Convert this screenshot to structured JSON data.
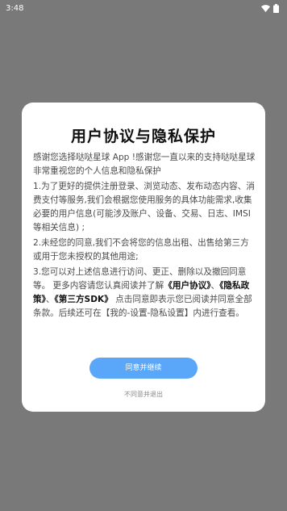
{
  "status_bar": {
    "time": "3:48",
    "icons": [
      "wifi-icon",
      "battery-icon"
    ]
  },
  "dialog": {
    "title": "用户协议与隐私保护",
    "intro": "感谢您选择哒哒星球 App !感谢您一直以来的支持哒哒星球非常重视您的个人信息和隐私保护",
    "item1": "1.为了更好的提供注册登录、浏览动态、发布动态内容、消费支付等服务,我们会根据您使用服务的具体功能需求,收集必要的用户信息(可能涉及账户、设备、交易、日志、IMSI等相关信息) ;",
    "item2": "2.未经您的同意,我们不会将您的信息出租、出售给第三方或用于您未授权的其他用途;",
    "item3_text": "3.您可以对上述信息进行访问、更正、删除以及撤回同意等。 更多内容请您认真阅读并了解",
    "link_user_agreement": "《用户协议》",
    "sep1": "、",
    "link_privacy_policy": "《隐私政策》",
    "sep2": "、",
    "link_third_party_sdk": "《第三方SDK》",
    "item3_tail": " 点击同意即表示您已阅读并同意全部条款。后续还可在【我的-设置-隐私设置】内进行查看。",
    "agree_label": "同意并继续",
    "decline_label": "不同意并退出"
  },
  "colors": {
    "overlay": "#797979",
    "dialog_bg": "#ffffff",
    "agree_button": "#5aa6f8"
  }
}
